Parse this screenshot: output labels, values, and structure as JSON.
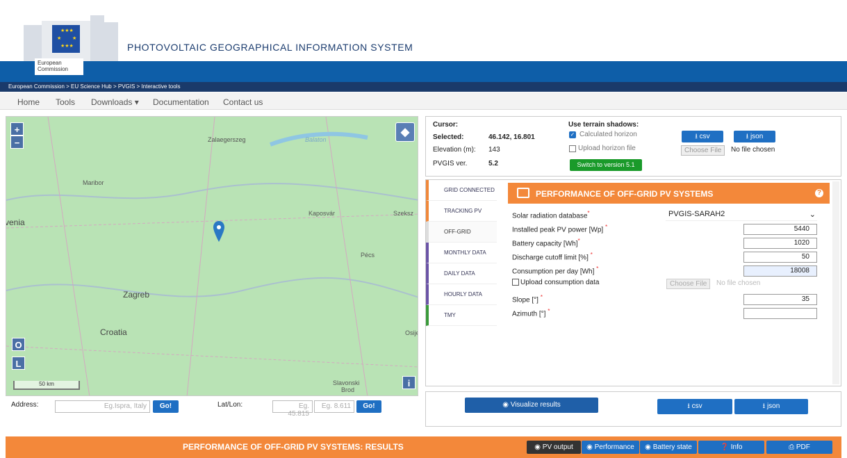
{
  "header": {
    "title": "PHOTOVOLTAIC GEOGRAPHICAL INFORMATION SYSTEM",
    "org_line1": "European",
    "org_line2": "Commission"
  },
  "breadcrumb": "European Commission > EU Science Hub > PVGIS > Interactive tools",
  "nav": {
    "home": "Home",
    "tools": "Tools",
    "downloads": "Downloads ▾",
    "documentation": "Documentation",
    "contact": "Contact us"
  },
  "map": {
    "places": {
      "zalaegerszeg": "Zalaegerszeg",
      "balaton": "Balaton",
      "maribor": "Maribor",
      "kaposvar": "Kaposvár",
      "szeksz": "Szeksz",
      "venia": "venia",
      "pecs": "Pécs",
      "zagreb": "Zagreb",
      "croatia": "Croatia",
      "osije": "Osije",
      "slavonski": "Slavonski",
      "brod": "Brod"
    },
    "zoom_in": "+",
    "zoom_out": "−",
    "btn_o": "O",
    "btn_l": "L",
    "btn_i": "i",
    "scale": "50 km"
  },
  "address": {
    "label": "Address:",
    "placeholder": "Eg.Ispra, Italy",
    "go": "Go!",
    "latlon_label": "Lat/Lon:",
    "lat_placeholder": "Eg. 45.815",
    "lon_placeholder": "Eg. 8.611",
    "go2": "Go!"
  },
  "info": {
    "cursor_label": "Cursor:",
    "selected_label": "Selected:",
    "selected_value": "46.142, 16.801",
    "elevation_label": "Elevation (m):",
    "elevation_value": "143",
    "pvgis_label": "PVGIS ver.",
    "pvgis_value": "5.2",
    "shadows_title": "Use terrain shadows:",
    "calc_horizon": "Calculated horizon",
    "upload_horizon": "Upload horizon file",
    "switch_btn": "Switch to version 5.1",
    "csv": "csv",
    "json": "json",
    "choose_file": "Choose File",
    "no_file": "No file chosen"
  },
  "tabs": [
    "GRID CONNECTED",
    "TRACKING PV",
    "OFF-GRID",
    "MONTHLY DATA",
    "DAILY DATA",
    "HOURLY DATA",
    "TMY"
  ],
  "tab_colors": [
    "#f0883a",
    "#f0883a",
    "#cccccc",
    "#6b54a6",
    "#6b54a6",
    "#6b54a6",
    "#3a9a3a"
  ],
  "form": {
    "title": "PERFORMANCE OF OFF-GRID PV SYSTEMS",
    "db_label": "Solar radiation database",
    "db_value": "PVGIS-SARAH2",
    "peak_label": "Installed peak PV power [Wp]",
    "peak_value": "5440",
    "battery_label": "Battery capacity [Wh]",
    "battery_value": "1020",
    "cutoff_label": "Discharge cutoff limit [%]",
    "cutoff_value": "50",
    "consumption_label": "Consumption per day [Wh]",
    "consumption_value": "18008",
    "upload_label": "Upload consumption data",
    "choose_file": "Choose File",
    "no_file": "No file chosen",
    "slope_label": "Slope [°]",
    "slope_value": "35",
    "azimuth_label": "Azimuth [°]",
    "azimuth_value": "",
    "star": "*"
  },
  "actions": {
    "visualize": "Visualize results",
    "csv": "csv",
    "json": "json"
  },
  "results": {
    "title": "PERFORMANCE OF OFF-GRID PV SYSTEMS: RESULTS",
    "pv_output": "PV output",
    "performance": "Performance",
    "battery_state": "Battery state",
    "info": "Info",
    "pdf": "PDF"
  }
}
